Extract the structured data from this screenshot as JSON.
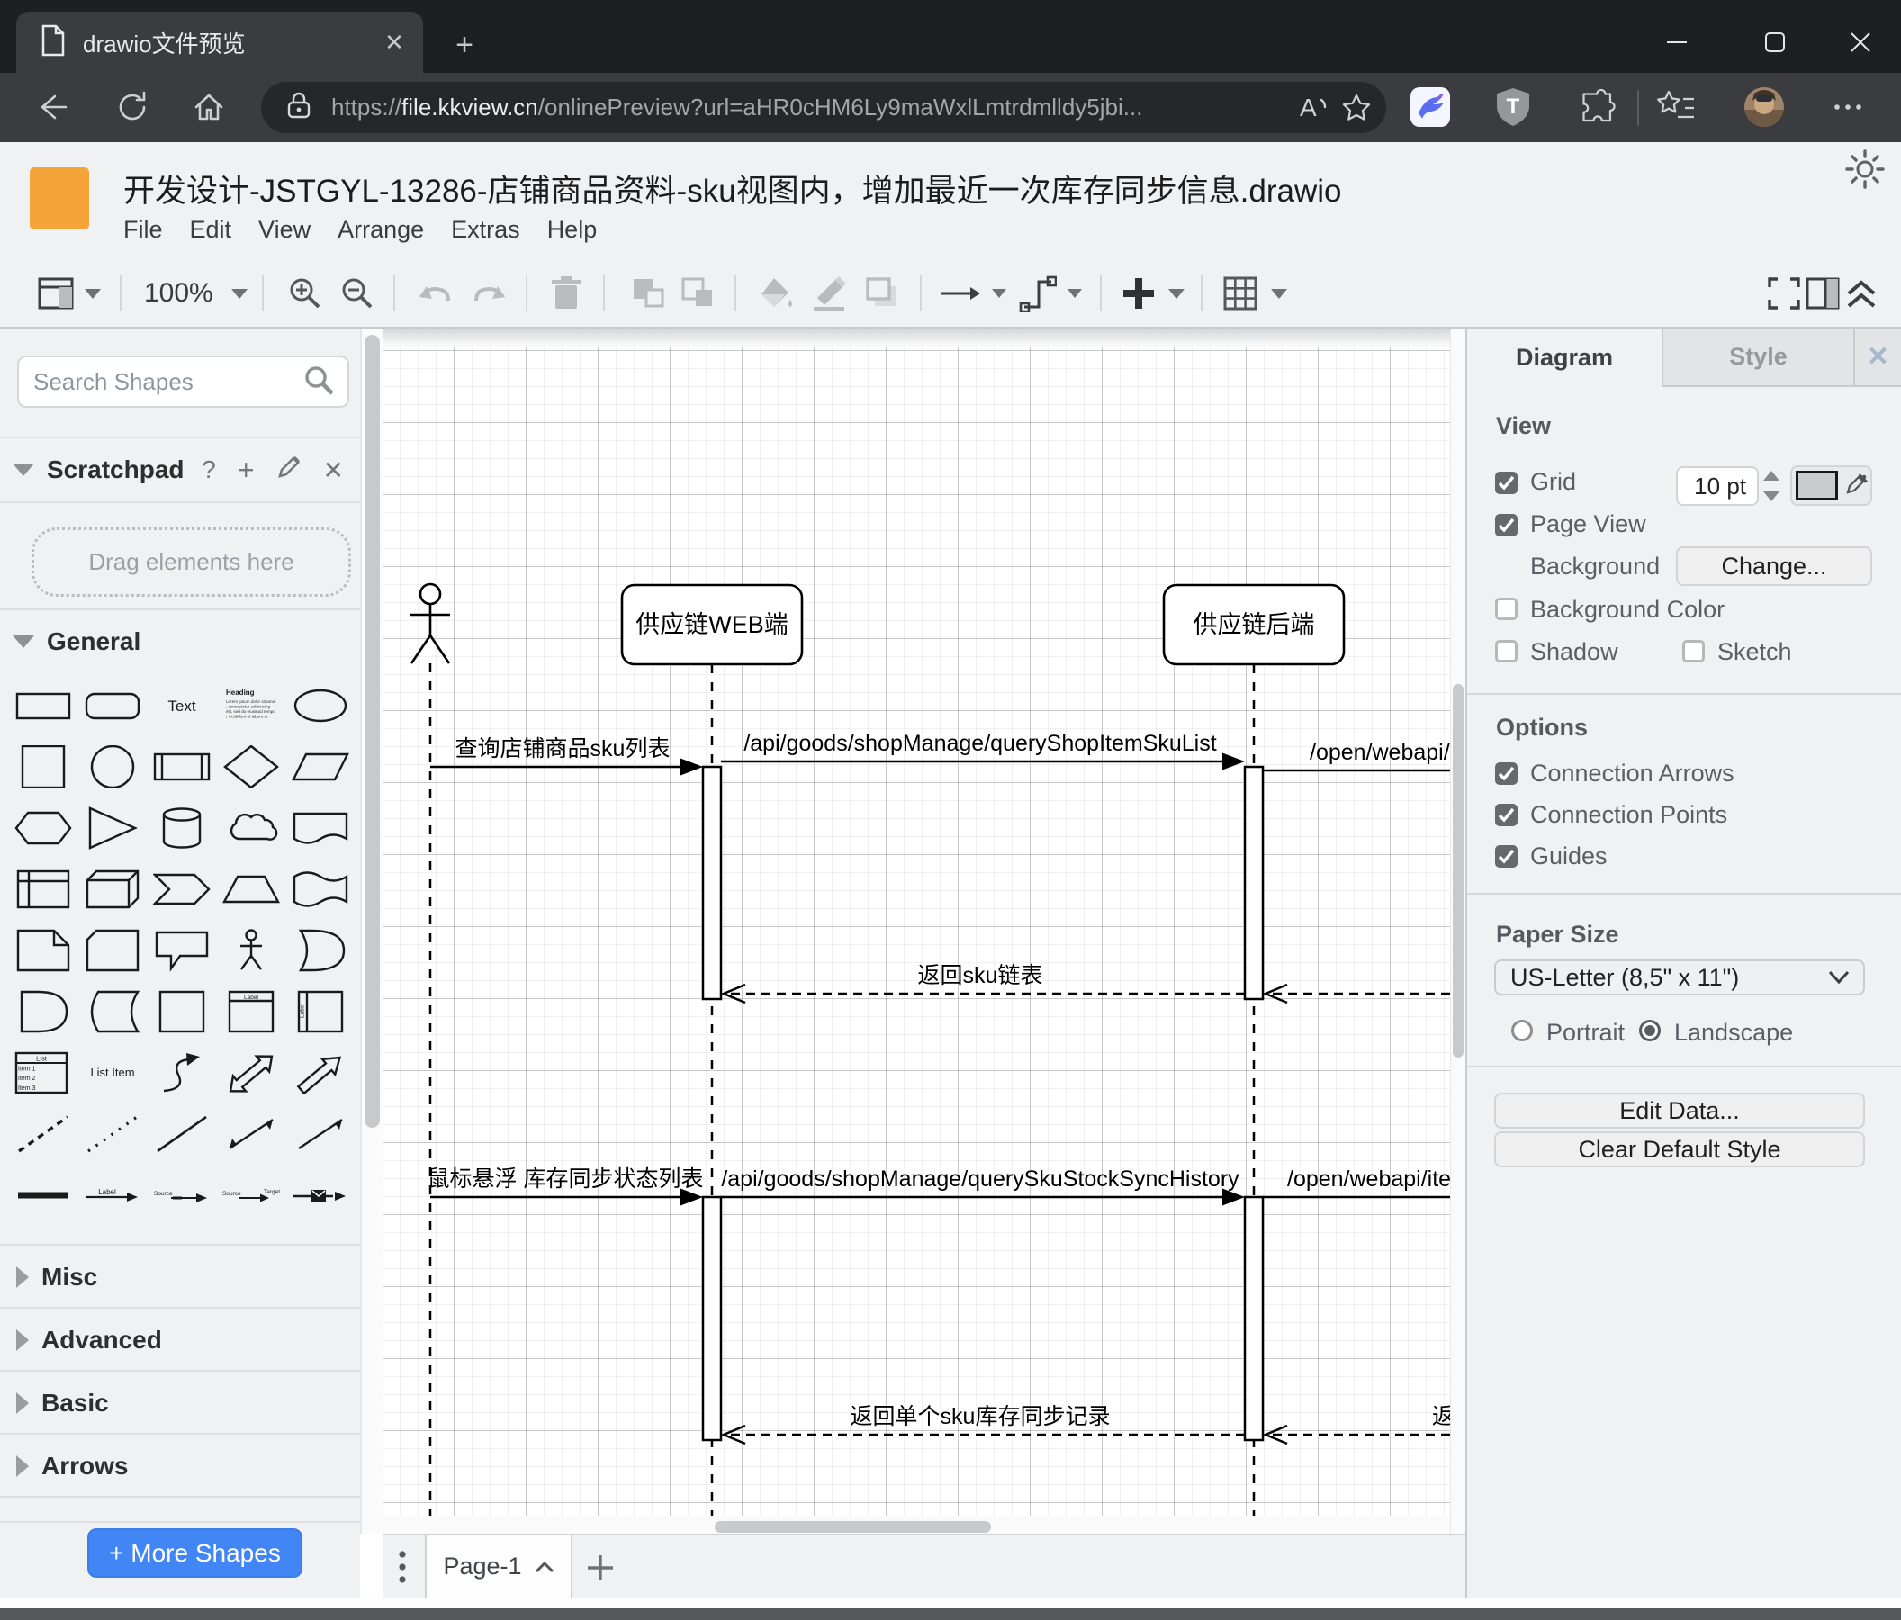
{
  "browser": {
    "tab_title": "drawio文件预览",
    "address": {
      "scheme": "https://",
      "domain": "file.kkview.cn",
      "path": "/onlinePreview?url=aHR0cHM6Ly9maWxlLmtrdmlldy5jbi..."
    }
  },
  "app": {
    "title": "开发设计-JSTGYL-13286-店铺商品资料-sku视图内，增加最近一次库存同步信息.drawio",
    "menus": [
      "File",
      "Edit",
      "View",
      "Arrange",
      "Extras",
      "Help"
    ],
    "toolbar": {
      "zoom_level": "100%"
    }
  },
  "sidebar": {
    "search_placeholder": "Search Shapes",
    "scratchpad_title": "Scratchpad",
    "scratchpad_hint": "Drag elements here",
    "sections": {
      "general": "General",
      "misc": "Misc",
      "advanced": "Advanced",
      "basic": "Basic",
      "arrows": "Arrows"
    },
    "more_shapes_label": "+ More Shapes",
    "shape_labels": {
      "text": "Text",
      "heading": "Heading",
      "heading_body": "Lorem ipsum dolor sit amet, consectetur adipisicing elit, sed do eiusmod tempor incididunt ut labore et dolore magna aliqua.",
      "list_title": "List",
      "list_item1": "Item 1",
      "list_item2": "Item 2",
      "list_item3": "Item 3",
      "list_item": "List Item",
      "label": "Label",
      "source": "Source",
      "target": "Target"
    }
  },
  "canvas": {
    "page_tab_label": "Page-1",
    "diagram": {
      "lifeline1": "供应链WEB端",
      "lifeline2": "供应链后端",
      "msg_query_sku_list": "查询店铺商品sku列表",
      "msg_api_query_shop_item_sku_list": "/api/goods/shopManage/queryShopItemSkuList",
      "msg_open_webapi": "/open/webapi/",
      "msg_return_sku_list": "返回sku链表",
      "msg_hover_stock_sync": "鼠标悬浮 库存同步状态列表",
      "msg_api_query_sku_stock_sync_history": "/api/goods/shopManage/querySkuStockSyncHistory",
      "msg_open_webapi_item": "/open/webapi/iten",
      "msg_return_single_sku": "返回单个sku库存同步记录",
      "msg_return_clipped": "返回"
    }
  },
  "panel": {
    "tabs": {
      "diagram": "Diagram",
      "style": "Style"
    },
    "view": {
      "heading": "View",
      "grid": "Grid",
      "grid_size": "10 pt",
      "page_view": "Page View",
      "background": "Background",
      "change": "Change...",
      "background_color": "Background Color",
      "shadow": "Shadow",
      "sketch": "Sketch"
    },
    "options": {
      "heading": "Options",
      "connection_arrows": "Connection Arrows",
      "connection_points": "Connection Points",
      "guides": "Guides"
    },
    "paper": {
      "heading": "Paper Size",
      "size_value": "US-Letter (8,5\" x 11\")",
      "portrait": "Portrait",
      "landscape": "Landscape"
    },
    "buttons": {
      "edit_data": "Edit Data...",
      "clear_default_style": "Clear Default Style"
    }
  },
  "colors": {
    "accent_blue": "#4285f4",
    "logo_orange": "#f5a43a",
    "chrome_dark": "#1e1f22"
  }
}
